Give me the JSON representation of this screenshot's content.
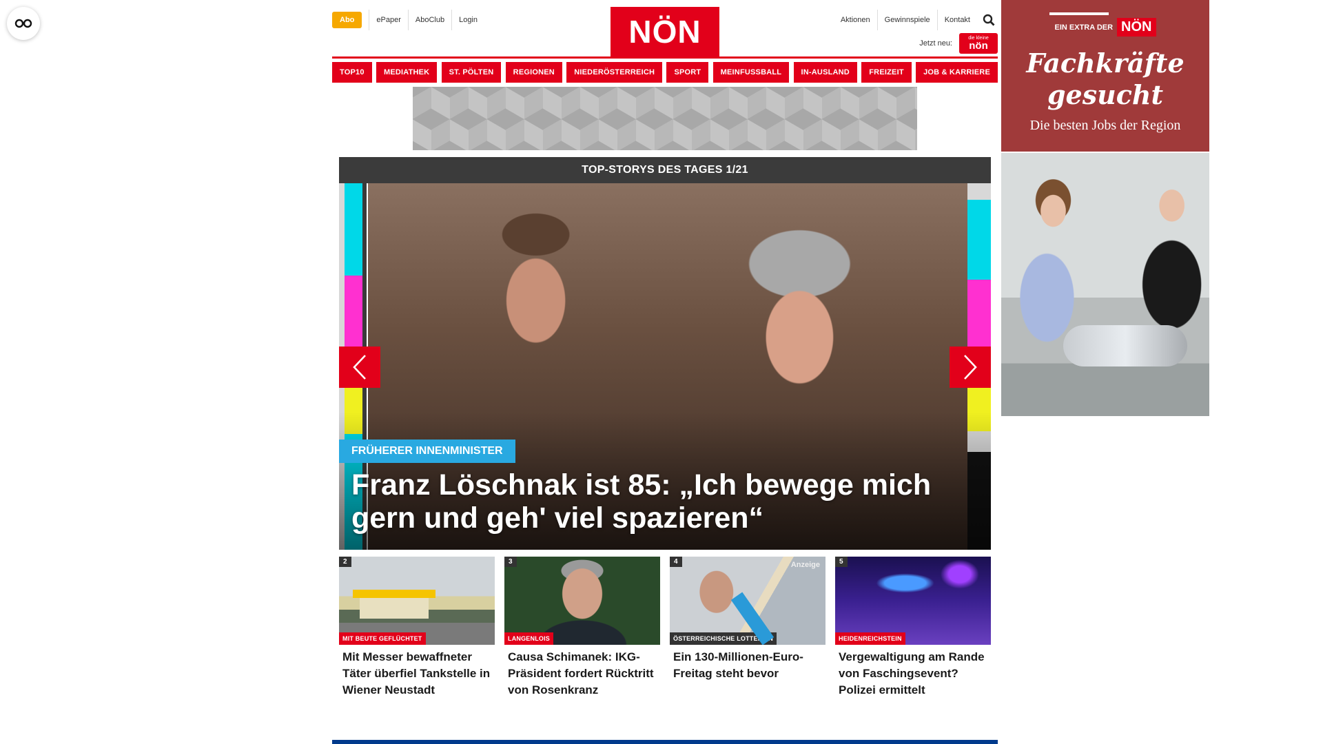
{
  "header": {
    "abo_label": "Abo",
    "left_links": [
      "ePaper",
      "AboClub",
      "Login"
    ],
    "logo_text": "NÖN",
    "right_links": [
      "Aktionen",
      "Gewinnspiele",
      "Kontakt"
    ],
    "jetzt_label": "Jetzt neu:",
    "jetzt_logo_small": "die kleine",
    "jetzt_logo_text": "nön"
  },
  "nav": {
    "items": [
      "TOP10",
      "MEDIATHEK",
      "ST. PÖLTEN",
      "REGIONEN",
      "NIEDERÖSTERREICH",
      "SPORT",
      "MEINFUSSBALL",
      "IN-AUSLAND",
      "FREIZEIT",
      "JOB & KARRIERE"
    ]
  },
  "topstory": {
    "header": "TOP-STORYS DES TAGES 1/21",
    "kicker": "FRÜHERER INNENMINISTER",
    "title": "Franz Löschnak ist 85: „Ich bewege mich gern und geh' viel spazieren“"
  },
  "cards": [
    {
      "num": "2",
      "kicker": "MIT BEUTE GEFLÜCHTET",
      "title": "Mit Messer bewaffneter Täter überfiel Tankstelle in Wiener Neustadt",
      "ad": ""
    },
    {
      "num": "3",
      "kicker": "LANGENLOIS",
      "title": "Causa Schimanek: IKG-Präsident fordert Rücktritt von Rosenkranz",
      "ad": ""
    },
    {
      "num": "4",
      "kicker": "ÖSTERREICHISCHE LOTTERIEN",
      "title": "Ein 130-Millionen-Euro-Freitag steht bevor",
      "ad": "Anzeige"
    },
    {
      "num": "5",
      "kicker": "HEIDENREICHSTEIN",
      "title": "Vergewaltigung am Rande von Faschingsevent? Polizei ermittelt",
      "ad": ""
    }
  ],
  "ad": {
    "extra_label": "EIN EXTRA DER",
    "extra_logo": "NÖN",
    "headline_1": "Fachkräfte",
    "headline_2": "gesucht",
    "sub": "Die besten Jobs der Region"
  },
  "colors": {
    "brand_red": "#e2001a",
    "abo_orange": "#f6a800",
    "kicker_blue": "#29a9e1",
    "bottom_bar_blue": "#003a8c",
    "ad_bg": "#a03a3a"
  }
}
